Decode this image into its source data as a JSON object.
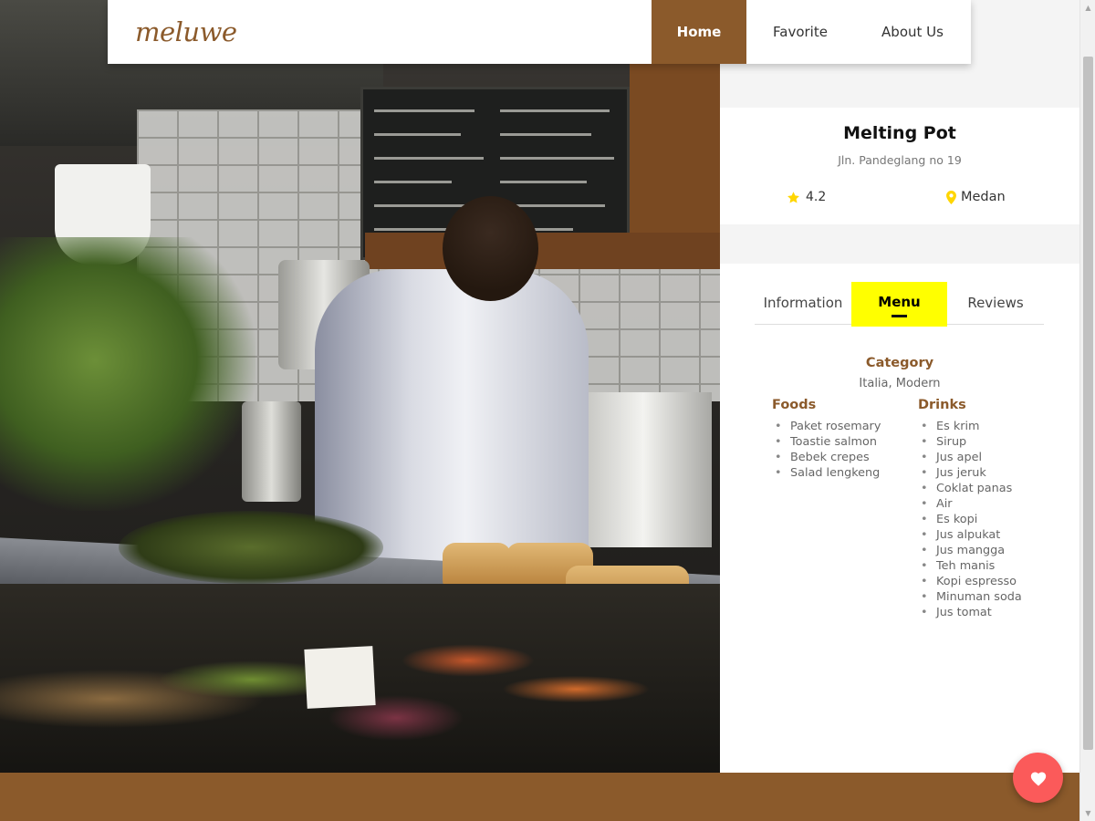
{
  "header": {
    "logo": "meluwe",
    "nav": [
      {
        "label": "Home",
        "active": true
      },
      {
        "label": "Favorite",
        "active": false
      },
      {
        "label": "About Us",
        "active": false
      }
    ]
  },
  "restaurant": {
    "name": "Melting Pot",
    "address": "Jln. Pandeglang no 19",
    "rating": "4.2",
    "city": "Medan"
  },
  "tabs": [
    {
      "label": "Information",
      "active": false
    },
    {
      "label": "Menu",
      "active": true
    },
    {
      "label": "Reviews",
      "active": false
    }
  ],
  "menu": {
    "category_title": "Category",
    "category_value": "Italia, Modern",
    "foods_title": "Foods",
    "drinks_title": "Drinks",
    "foods": [
      "Paket rosemary",
      "Toastie salmon",
      "Bebek crepes",
      "Salad lengkeng"
    ],
    "drinks": [
      "Es krim",
      "Sirup",
      "Jus apel",
      "Jus jeruk",
      "Coklat panas",
      "Air",
      "Es kopi",
      "Jus alpukat",
      "Jus mangga",
      "Teh manis",
      "Kopi espresso",
      "Minuman soda",
      "Jus tomat"
    ]
  },
  "icons": {
    "rating": "star-icon",
    "location": "map-pin-icon",
    "favorite_fab": "heart-icon"
  },
  "colors": {
    "brand": "#8b5a2b",
    "active_tab": "#ffff00",
    "star": "#ffd600",
    "fab": "#fb5a5a"
  }
}
